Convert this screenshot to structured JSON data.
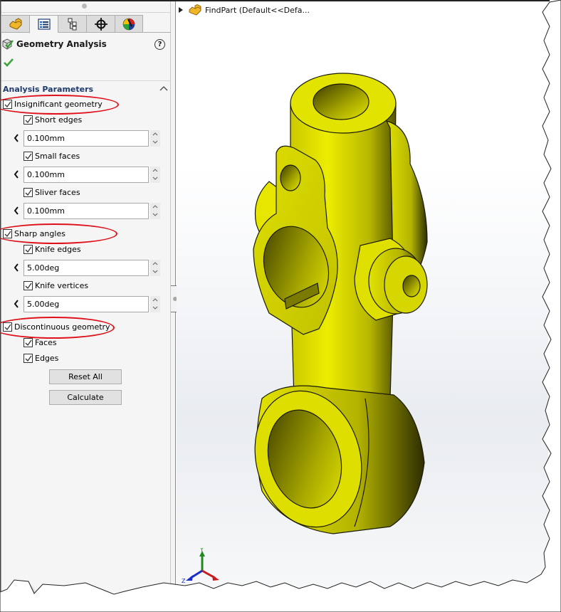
{
  "property_manager": {
    "tabs": [
      {
        "icon": "feature-manager-icon",
        "active": false
      },
      {
        "icon": "property-manager-icon",
        "active": true
      },
      {
        "icon": "configuration-manager-icon",
        "active": false
      },
      {
        "icon": "dimxpert-manager-icon",
        "active": false
      },
      {
        "icon": "display-manager-icon",
        "active": false
      }
    ],
    "title": "Geometry Analysis",
    "help_label": "?",
    "section": {
      "header": "Analysis Parameters",
      "groups": [
        {
          "label": "Insignificant geometry",
          "checked": true,
          "highlighted": true,
          "options": [
            {
              "label": "Short edges",
              "checked": true,
              "value": "0.100mm"
            },
            {
              "label": "Small faces",
              "checked": true,
              "value": "0.100mm"
            },
            {
              "label": "Sliver faces",
              "checked": true,
              "value": "0.100mm"
            }
          ]
        },
        {
          "label": "Sharp angles",
          "checked": true,
          "highlighted": true,
          "options": [
            {
              "label": "Knife edges",
              "checked": true,
              "value": "5.00deg"
            },
            {
              "label": "Knife vertices",
              "checked": true,
              "value": "5.00deg"
            }
          ]
        },
        {
          "label": "Discontinuous geometry",
          "checked": true,
          "highlighted": true,
          "options": [
            {
              "label": "Faces",
              "checked": true
            },
            {
              "label": "Edges",
              "checked": true
            }
          ]
        }
      ]
    },
    "buttons": {
      "reset_all": "Reset All",
      "calculate": "Calculate"
    }
  },
  "viewport": {
    "tree_item": "FindPart  (Default<<Defa...",
    "triad_labels": {
      "y": "Y",
      "z": "Z"
    },
    "model_color": "#e6e600",
    "annotation_color": "#e0101a"
  }
}
